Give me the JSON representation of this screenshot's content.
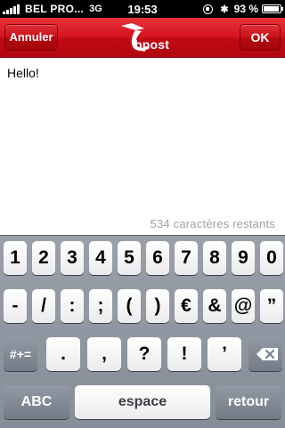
{
  "status_bar": {
    "carrier": "BEL PRO...",
    "network": "3G",
    "time": "19:53",
    "battery_percent": "93 %",
    "battery_level": 0.93
  },
  "nav": {
    "cancel_label": "Annuler",
    "ok_label": "OK",
    "logo_text": "bpost",
    "brand_color": "#d4131d"
  },
  "content": {
    "message": "Hello!",
    "counter": "534 caractères restants"
  },
  "keyboard": {
    "row1": [
      "1",
      "2",
      "3",
      "4",
      "5",
      "6",
      "7",
      "8",
      "9",
      "0"
    ],
    "row2": [
      "-",
      "/",
      ":",
      ";",
      "(",
      ")",
      "€",
      "&",
      "@",
      "”"
    ],
    "row3": {
      "mode_key": "#+=",
      "keys": [
        ".",
        ",",
        "?",
        "!",
        "’"
      ],
      "delete_icon": "backspace-icon"
    },
    "row4": {
      "abc_key": "ABC",
      "space_key": "espace",
      "return_key": "retour"
    }
  }
}
